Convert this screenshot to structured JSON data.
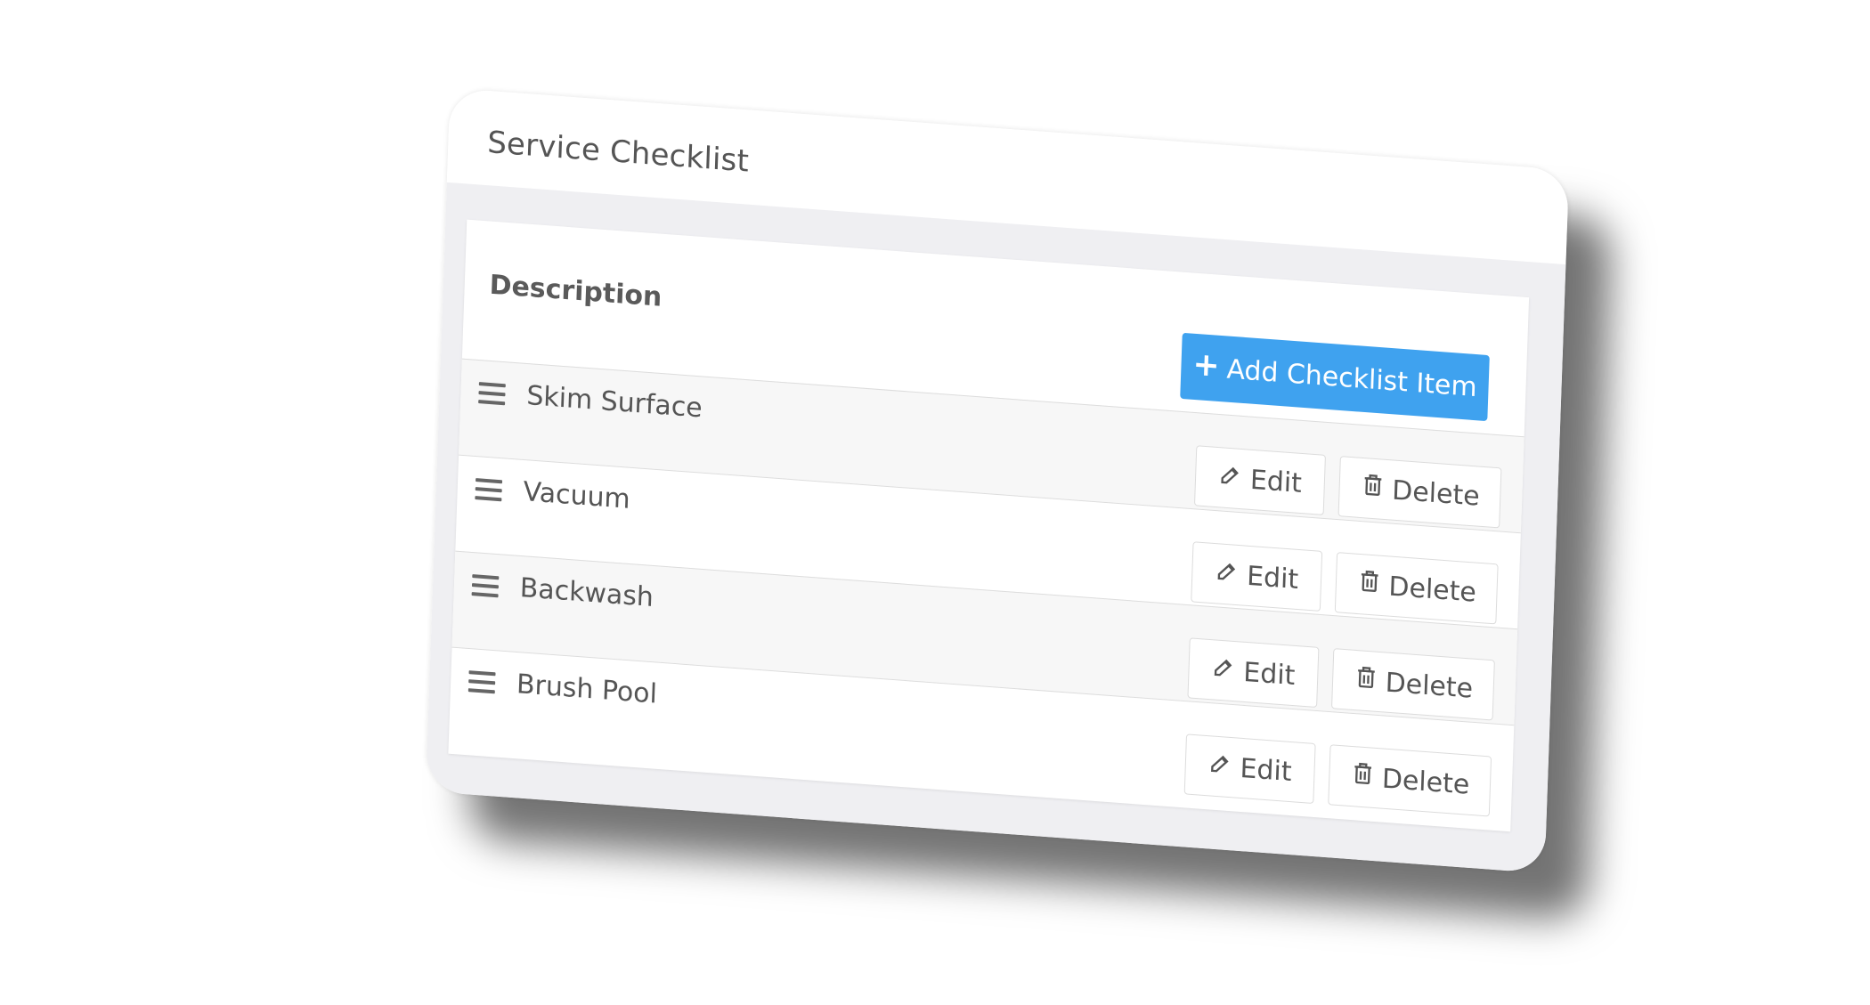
{
  "card": {
    "title": "Service Checklist"
  },
  "table": {
    "column_header": "Description",
    "add_button": {
      "icon": "plus-icon",
      "label": "Add Checklist Item"
    },
    "rows": [
      {
        "label": "Skim Surface",
        "edit_label": "Edit",
        "delete_label": "Delete"
      },
      {
        "label": "Vacuum",
        "edit_label": "Edit",
        "delete_label": "Delete"
      },
      {
        "label": "Backwash",
        "edit_label": "Edit",
        "delete_label": "Delete"
      },
      {
        "label": "Brush Pool",
        "edit_label": "Edit",
        "delete_label": "Delete"
      }
    ]
  },
  "colors": {
    "accent": "#3fa2ef",
    "body_background": "#efeff2",
    "striped_row": "#f7f7f7"
  },
  "icons": {
    "drag": "drag-handle-icon",
    "edit": "edit-icon",
    "delete": "trash-icon"
  }
}
